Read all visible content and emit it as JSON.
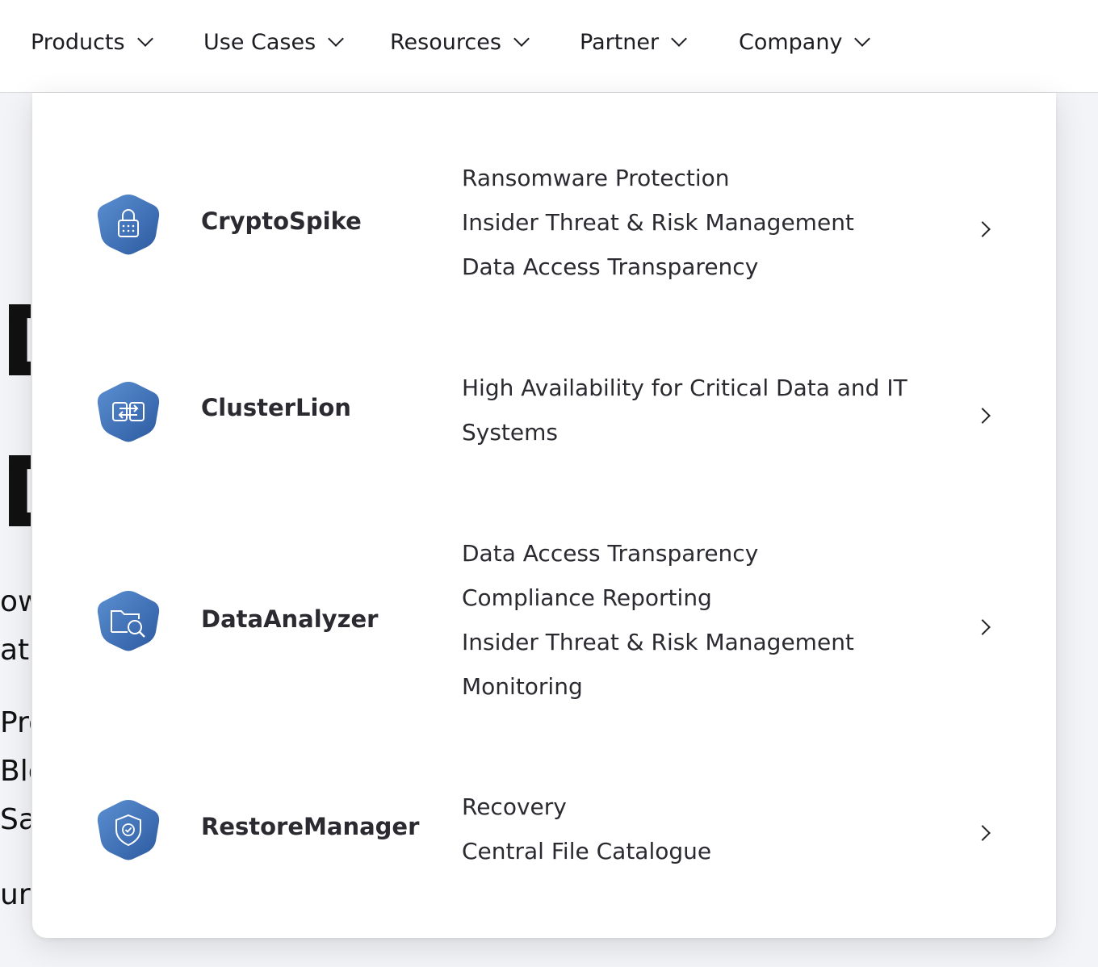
{
  "nav": {
    "items": [
      {
        "label": "Products"
      },
      {
        "label": "Use Cases"
      },
      {
        "label": "Resources"
      },
      {
        "label": "Partner"
      },
      {
        "label": "Company"
      }
    ]
  },
  "background_fragments": [
    "D",
    "D",
    "ow",
    "ata",
    "Pro",
    "Blo",
    "Saf",
    "ur s"
  ],
  "products": [
    {
      "name": "CryptoSpike",
      "icon": "lock-icon",
      "features": [
        "Ransomware Protection",
        "Insider Threat & Risk Management",
        "Data Access Transparency"
      ]
    },
    {
      "name": "ClusterLion",
      "icon": "cluster-arrows-icon",
      "features": [
        "High Availability for Critical Data and IT",
        "Systems"
      ]
    },
    {
      "name": "DataAnalyzer",
      "icon": "folder-search-icon",
      "features": [
        "Data Access Transparency",
        "Compliance Reporting",
        "Insider Threat & Risk Management",
        "Monitoring"
      ]
    },
    {
      "name": "RestoreManager",
      "icon": "shield-check-icon",
      "features": [
        "Recovery",
        "Central File Catalogue"
      ]
    }
  ],
  "colors": {
    "icon_gradient_start": "#5a8ccf",
    "icon_gradient_end": "#2f5fa6",
    "text": "#2a2a30"
  }
}
